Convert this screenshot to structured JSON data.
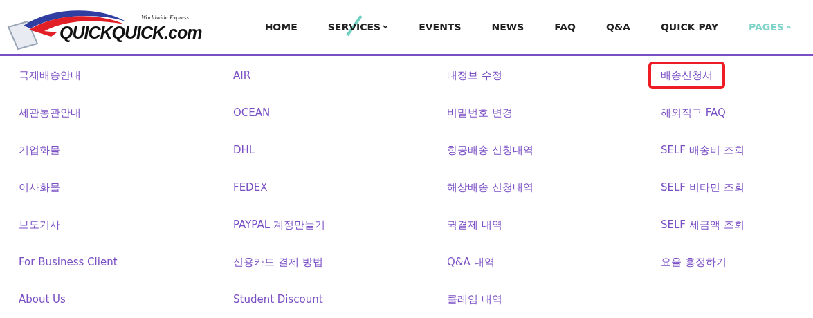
{
  "logo": {
    "tagline": "Worldwide Express",
    "name": "QUICKQUICK.com"
  },
  "nav": [
    {
      "label": "HOME",
      "selected": false,
      "has_dropdown": false,
      "expanded": false
    },
    {
      "label": "SERVICES",
      "selected": false,
      "has_dropdown": true,
      "expanded": false
    },
    {
      "label": "EVENTS",
      "selected": false,
      "has_dropdown": false,
      "expanded": false
    },
    {
      "label": "NEWS",
      "selected": false,
      "has_dropdown": false,
      "expanded": false
    },
    {
      "label": "FAQ",
      "selected": false,
      "has_dropdown": false,
      "expanded": false
    },
    {
      "label": "Q&A",
      "selected": false,
      "has_dropdown": false,
      "expanded": false
    },
    {
      "label": "QUICK PAY",
      "selected": false,
      "has_dropdown": false,
      "expanded": false
    },
    {
      "label": "PAGES",
      "selected": true,
      "has_dropdown": true,
      "expanded": true
    }
  ],
  "menu_columns": [
    {
      "items": [
        {
          "label": "국제배송안내",
          "highlighted": false
        },
        {
          "label": "세관통관안내",
          "highlighted": false
        },
        {
          "label": "기업화물",
          "highlighted": false
        },
        {
          "label": "이사화물",
          "highlighted": false
        },
        {
          "label": "보도기사",
          "highlighted": false
        },
        {
          "label": "For Business Client",
          "highlighted": false
        },
        {
          "label": "About Us",
          "highlighted": false
        }
      ]
    },
    {
      "items": [
        {
          "label": "AIR",
          "highlighted": false
        },
        {
          "label": "OCEAN",
          "highlighted": false
        },
        {
          "label": "DHL",
          "highlighted": false
        },
        {
          "label": "FEDEX",
          "highlighted": false
        },
        {
          "label": "PAYPAL 계정만들기",
          "highlighted": false
        },
        {
          "label": "신용카드 결제 방법",
          "highlighted": false
        },
        {
          "label": "Student Discount",
          "highlighted": false
        }
      ]
    },
    {
      "items": [
        {
          "label": "내정보 수정",
          "highlighted": false
        },
        {
          "label": "비밀번호 변경",
          "highlighted": false
        },
        {
          "label": "항공배송 신청내역",
          "highlighted": false
        },
        {
          "label": "해상배송 신청내역",
          "highlighted": false
        },
        {
          "label": "퀵결제 내역",
          "highlighted": false
        },
        {
          "label": "Q&A 내역",
          "highlighted": false
        },
        {
          "label": "클레임 내역",
          "highlighted": false
        }
      ]
    },
    {
      "items": [
        {
          "label": "배송신청서",
          "highlighted": true
        },
        {
          "label": "해외직구 FAQ",
          "highlighted": false
        },
        {
          "label": "SELF 배송비 조회",
          "highlighted": false
        },
        {
          "label": "SELF 비타민 조회",
          "highlighted": false
        },
        {
          "label": "SELF 세금액 조회",
          "highlighted": false
        },
        {
          "label": "요율 흥정하기",
          "highlighted": false
        }
      ]
    }
  ]
}
